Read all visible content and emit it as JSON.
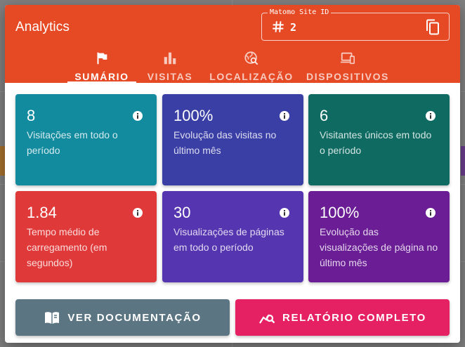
{
  "header": {
    "title": "Analytics",
    "site_id_label": "Matomo Site ID",
    "site_id_value": "2",
    "color": "#e64a25"
  },
  "tabs": [
    {
      "label": "SUMÁRIO",
      "icon": "flag-icon",
      "active": true
    },
    {
      "label": "VISITAS",
      "icon": "bar-chart-icon",
      "active": false
    },
    {
      "label": "LOCALIZAÇÃO",
      "icon": "globe-search-icon",
      "active": false
    },
    {
      "label": "DISPOSITIVOS",
      "icon": "devices-icon",
      "active": false
    }
  ],
  "cards": [
    {
      "value": "8",
      "desc": "Visitações em todo o período",
      "color": "#138b9e"
    },
    {
      "value": "100%",
      "desc": "Evolução das visitas no último mês",
      "color": "#3a3fa6"
    },
    {
      "value": "6",
      "desc": "Visitantes únicos em todo o período",
      "color": "#0f6b62"
    },
    {
      "value": "1.84",
      "desc": "Tempo médio de carregamento (em segundos)",
      "color": "#e03939"
    },
    {
      "value": "30",
      "desc": "Visualizações de páginas em todo o período",
      "color": "#5635b0"
    },
    {
      "value": "100%",
      "desc": "Evolução das visualizações de página no último mês",
      "color": "#6a1d95"
    }
  ],
  "buttons": {
    "docs": {
      "label": "VER DOCUMENTAÇÃO",
      "icon": "book-icon",
      "color": "#5b7583"
    },
    "report": {
      "label": "RELATÓRIO COMPLETO",
      "icon": "chart-search-icon",
      "color": "#e52063"
    }
  }
}
